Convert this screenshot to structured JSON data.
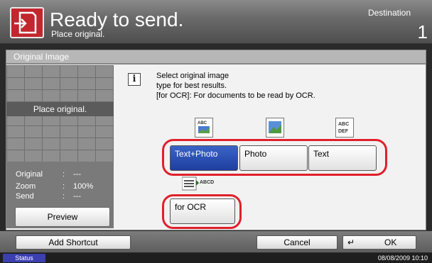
{
  "header": {
    "title": "Ready to send.",
    "subtitle": "Place original.",
    "destination_label": "Destination",
    "destination_count": "1"
  },
  "section": {
    "title": "Original Image"
  },
  "preview_panel": {
    "place_text": "Place original.",
    "info": [
      {
        "label": "Original",
        "value": "---"
      },
      {
        "label": "Zoom",
        "value": "100%"
      },
      {
        "label": "Send",
        "value": "---"
      }
    ],
    "preview_button": "Preview"
  },
  "message": {
    "lines": [
      "Select original image",
      "type for best results.",
      "[for OCR]: For documents to be read by OCR."
    ]
  },
  "options": {
    "text_photo": "Text+Photo",
    "photo": "Photo",
    "text": "Text",
    "for_ocr": "for OCR",
    "selected": "Text+Photo"
  },
  "icons": {
    "text_photo": "text-photo-icon",
    "photo": "photo-icon",
    "text": "text-icon",
    "ocr": "ocr-icon",
    "info": "info-icon"
  },
  "footer": {
    "add_shortcut": "Add Shortcut",
    "cancel": "Cancel",
    "ok": "OK"
  },
  "status_bar": {
    "status": "Status",
    "datetime": "08/08/2009   10:10"
  },
  "colors": {
    "selected": "#1e3f9e",
    "highlight_ring": "#e0202a",
    "send_icon": "#c1272d"
  }
}
